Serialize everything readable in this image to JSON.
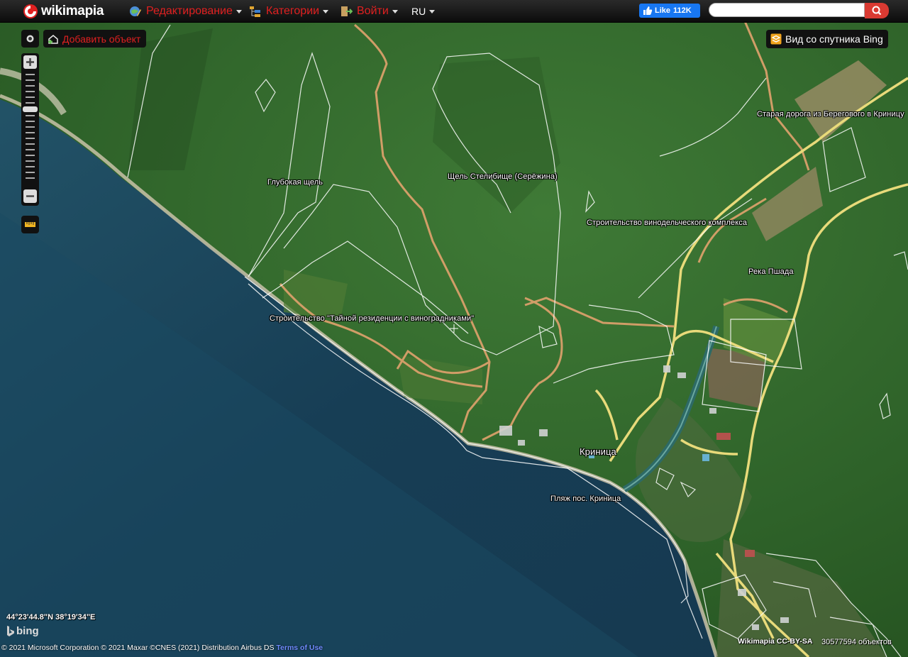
{
  "brand": "wikimapia",
  "nav": {
    "edit": "Редактирование",
    "categories": "Категории",
    "login": "Войти",
    "lang": "RU"
  },
  "facebook": {
    "label": "Like",
    "count": "112K"
  },
  "search": {
    "placeholder": "",
    "value": ""
  },
  "controls": {
    "add_object": "Добавить объект",
    "satellite_view": "Вид со спутника Bing"
  },
  "labels": {
    "deep_gorge": "Глубокая щель",
    "gorge_stelibishche": "Щель Стелибище (Серёжина)",
    "old_road": "Старая дорога из Берегового в Криницу",
    "winery": "Строительство винодельческого комплекса",
    "river": "Река Пшада",
    "secret_residence": "Строительство \"Тайной резиденции с виноградниками\"",
    "krinitsa": "Криница",
    "beach": "Пляж пос. Криница"
  },
  "coords": "44°23'44.8\"N 38°19'34\"E",
  "bing_logo": "bing",
  "copyright": "© 2021 Microsoft Corporation © 2021 Maxar ©CNES (2021) Distribution Airbus DS",
  "terms": "Terms of Use",
  "credit": "Wikimapia CC-BY-SA",
  "objects_count": "30577594 объектов",
  "colors": {
    "accent": "#e02020",
    "fb": "#1877f2",
    "search_btn": "#d93a32"
  }
}
